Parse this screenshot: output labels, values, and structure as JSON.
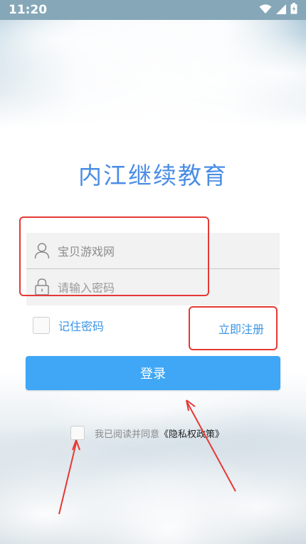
{
  "status_bar": {
    "time": "11:20",
    "icons": [
      "wifi-icon",
      "cell-signal-icon",
      "battery-charging-icon"
    ]
  },
  "app": {
    "title": "内江继续教育",
    "accent_color": "#4a8de6"
  },
  "form": {
    "username_value": "宝贝游戏网",
    "password_placeholder": "请输入密码"
  },
  "remember": {
    "label": "记住密码",
    "checked": false
  },
  "register": {
    "label": "立即注册"
  },
  "login_button": {
    "label": "登录",
    "color": "#3fa7f5"
  },
  "agreement": {
    "text": "我已阅读并同意",
    "link": "《隐私权政策》",
    "checked": false
  },
  "annotation_color": "#e53935"
}
